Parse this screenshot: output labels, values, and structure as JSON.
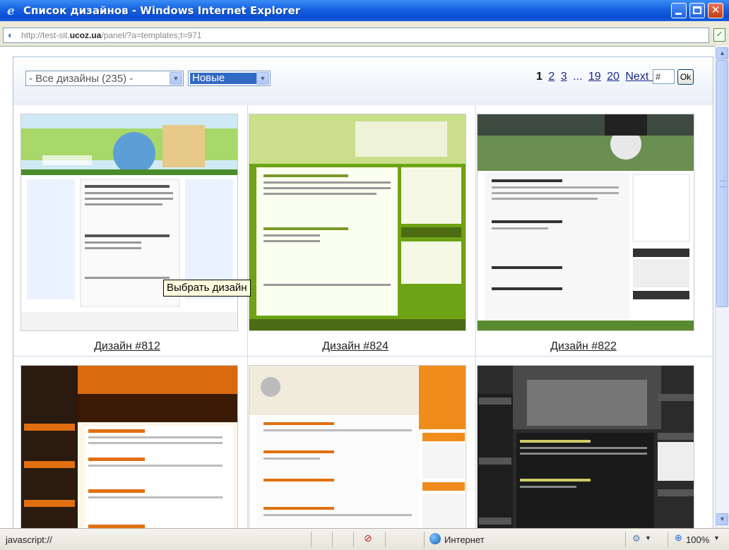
{
  "window": {
    "title": "Список дизайнов - Windows Internet Explorer",
    "close_glyph": "✕"
  },
  "address": {
    "url_prefix": "http://test-sit.",
    "url_domain": "ucoz.ua",
    "url_suffix": "/panel/?a=templates;t=971"
  },
  "filters": {
    "category_value": "- Все дизайны (235) -",
    "sort_value": "Новые"
  },
  "pager": {
    "current": "1",
    "pages": [
      "2",
      "3"
    ],
    "ellipsis": "...",
    "last_pages": [
      "19",
      "20"
    ],
    "next_label": "Next »",
    "page_input_value": "#",
    "ok_label": "Ok"
  },
  "designs": [
    {
      "caption": "Дизайн #812",
      "color": "#6fb23a"
    },
    {
      "caption": "Дизайн #824",
      "color": "#8cbe1e"
    },
    {
      "caption": "Дизайн #822",
      "color": "#2a2a2a"
    },
    {
      "caption": "",
      "color": "#e88a1a"
    },
    {
      "caption": "",
      "color": "#f08c1c"
    },
    {
      "caption": "",
      "color": "#333333"
    }
  ],
  "tooltip": "Выбрать дизайн",
  "statusbar": {
    "left_text": "javascript://",
    "zone_text": "Интернет",
    "zoom_text": "100%"
  }
}
